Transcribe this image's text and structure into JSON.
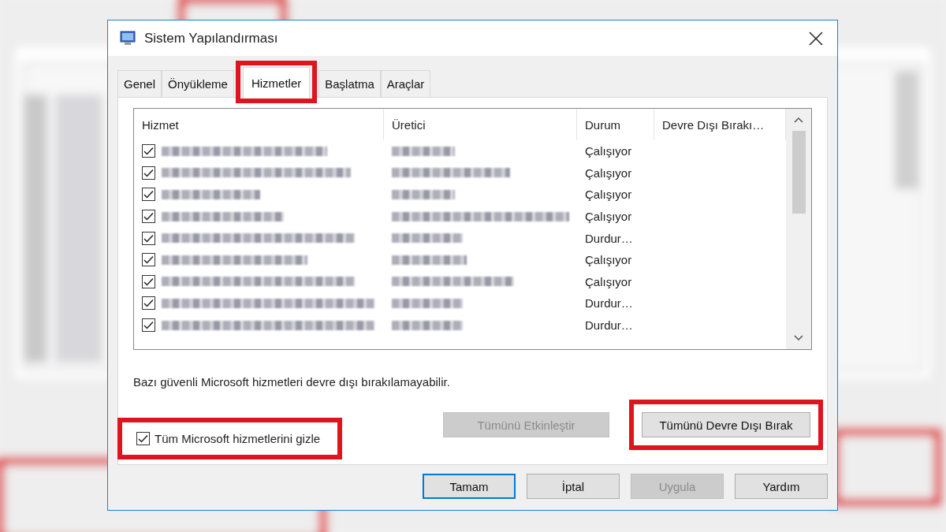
{
  "window": {
    "title": "Sistem Yapılandırması"
  },
  "tabs": [
    {
      "label": "Genel",
      "selected": false,
      "highlighted": false
    },
    {
      "label": "Önyükleme",
      "selected": false,
      "highlighted": false
    },
    {
      "label": "Hizmetler",
      "selected": true,
      "highlighted": true
    },
    {
      "label": "Başlatma",
      "selected": false,
      "highlighted": false
    },
    {
      "label": "Araçlar",
      "selected": false,
      "highlighted": false
    }
  ],
  "table": {
    "columns": [
      "Hizmet",
      "Üretici",
      "Durum",
      "Devre Dışı Bırakı…"
    ],
    "rows": [
      {
        "checked": true,
        "status": "Çalışıyor"
      },
      {
        "checked": true,
        "status": "Çalışıyor"
      },
      {
        "checked": true,
        "status": "Çalışıyor"
      },
      {
        "checked": true,
        "status": "Çalışıyor"
      },
      {
        "checked": true,
        "status": "Durdur…"
      },
      {
        "checked": true,
        "status": "Çalışıyor"
      },
      {
        "checked": true,
        "status": "Çalışıyor"
      },
      {
        "checked": true,
        "status": "Durdur…"
      },
      {
        "checked": true,
        "status": "Durdur…"
      }
    ]
  },
  "note": "Bazı güvenli Microsoft hizmetleri devre dışı bırakılamayabilir.",
  "buttons": [
    {
      "label": "Tümünü Etkinleştir",
      "disabled": true,
      "highlighted": false
    },
    {
      "label": "Tümünü Devre Dışı Bırak",
      "disabled": false,
      "highlighted": true
    }
  ],
  "hide_microsoft": {
    "label": "Tüm Microsoft hizmetlerini gizle",
    "checked": true,
    "highlighted": true
  },
  "footer_buttons": [
    {
      "label": "Tamam",
      "default": true,
      "disabled": false
    },
    {
      "label": "İptal",
      "default": false,
      "disabled": false
    },
    {
      "label": "Uygula",
      "default": false,
      "disabled": true
    },
    {
      "label": "Yardım",
      "default": false,
      "disabled": false
    }
  ]
}
